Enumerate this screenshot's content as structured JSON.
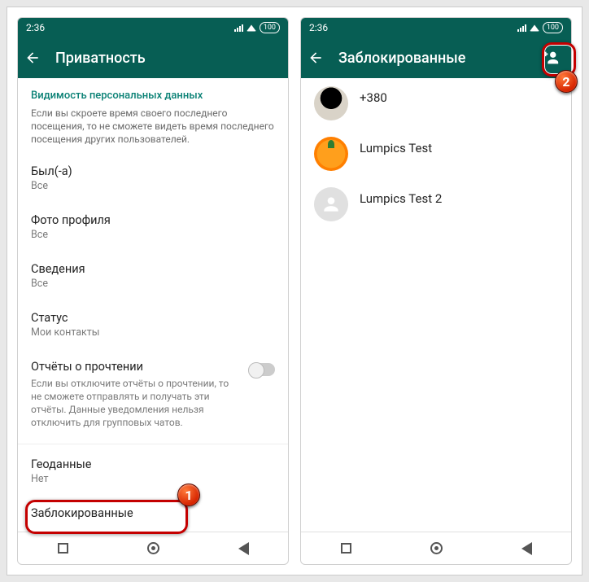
{
  "statusbar": {
    "time": "2:36",
    "battery": "100"
  },
  "left": {
    "appbar_title": "Приватность",
    "section_title": "Видимость персональных данных",
    "section_desc": "Если вы скроете время своего последнего посещения, то не сможете видеть время последнего посещения других пользователей.",
    "items": {
      "last_seen": {
        "label": "Был(-а)",
        "value": "Все"
      },
      "photo": {
        "label": "Фото профиля",
        "value": "Все"
      },
      "about": {
        "label": "Сведения",
        "value": "Все"
      },
      "status": {
        "label": "Статус",
        "value": "Мои контакты"
      },
      "read_receipts": {
        "label": "Отчёты о прочтении",
        "desc": "Если вы отключите отчёты о прочтении, то не сможете отправлять и получать эти отчёты. Данные уведомления нельзя отключить для групповых чатов."
      },
      "geo": {
        "label": "Геоданные",
        "value": "Нет"
      },
      "blocked": {
        "label": "Заблокированные"
      }
    }
  },
  "right": {
    "appbar_title": "Заблокированные",
    "contacts": [
      {
        "name": "+380"
      },
      {
        "name": "Lumpics Test"
      },
      {
        "name": "Lumpics Test 2"
      }
    ]
  },
  "callouts": {
    "one": "1",
    "two": "2"
  }
}
